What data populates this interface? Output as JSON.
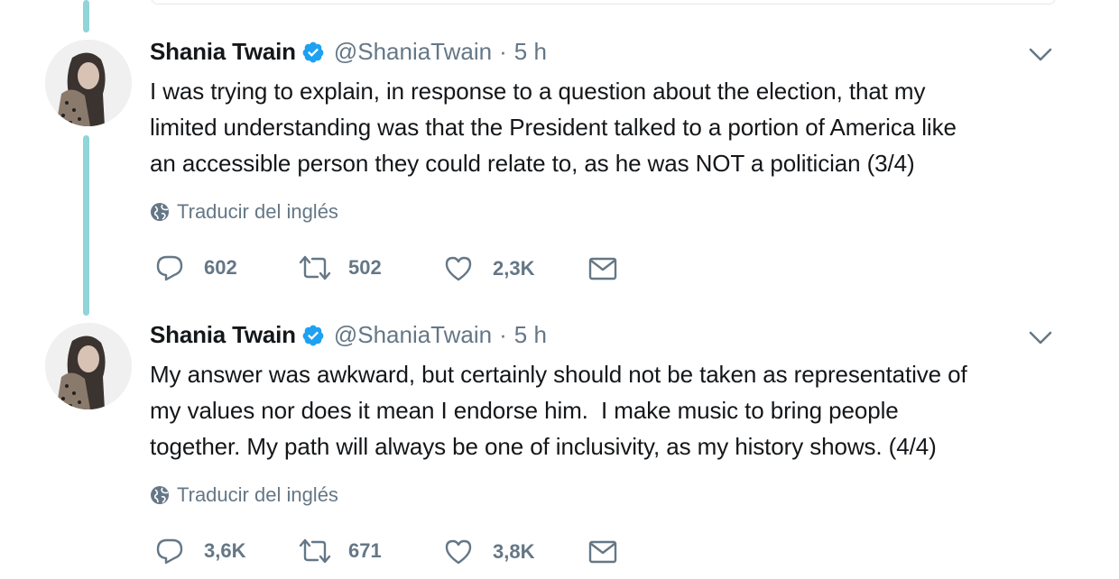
{
  "tweets": [
    {
      "name": "Shania Twain",
      "handle": "@ShaniaTwain",
      "separator": "·",
      "time": "5 h",
      "text": "I was trying to explain, in response to a question about the election, that my\nlimited understanding was that the President talked to a portion of America like\nan accessible person they could relate to, as he was NOT a politician (3/4)",
      "translate": "Traducir del inglés",
      "replies": "602",
      "retweets": "502",
      "likes": "2,3K"
    },
    {
      "name": "Shania Twain",
      "handle": "@ShaniaTwain",
      "separator": "·",
      "time": "5 h",
      "text": "My answer was awkward, but certainly should not be taken as representative of\nmy values nor does it mean I endorse him.  I make music to bring people\ntogether. My path will always be one of inclusivity, as my history shows. (4/4)",
      "translate": "Traducir del inglés",
      "replies": "3,6K",
      "retweets": "671",
      "likes": "3,8K"
    }
  ],
  "colors": {
    "thread_line": "#8fd5d9",
    "verified": "#1da1f2",
    "secondary_text": "#657786",
    "primary_text": "#14171a"
  },
  "icons": [
    "verified-badge-icon",
    "chevron-down-icon",
    "globe-icon",
    "reply-icon",
    "retweet-icon",
    "like-icon",
    "direct-message-icon"
  ]
}
